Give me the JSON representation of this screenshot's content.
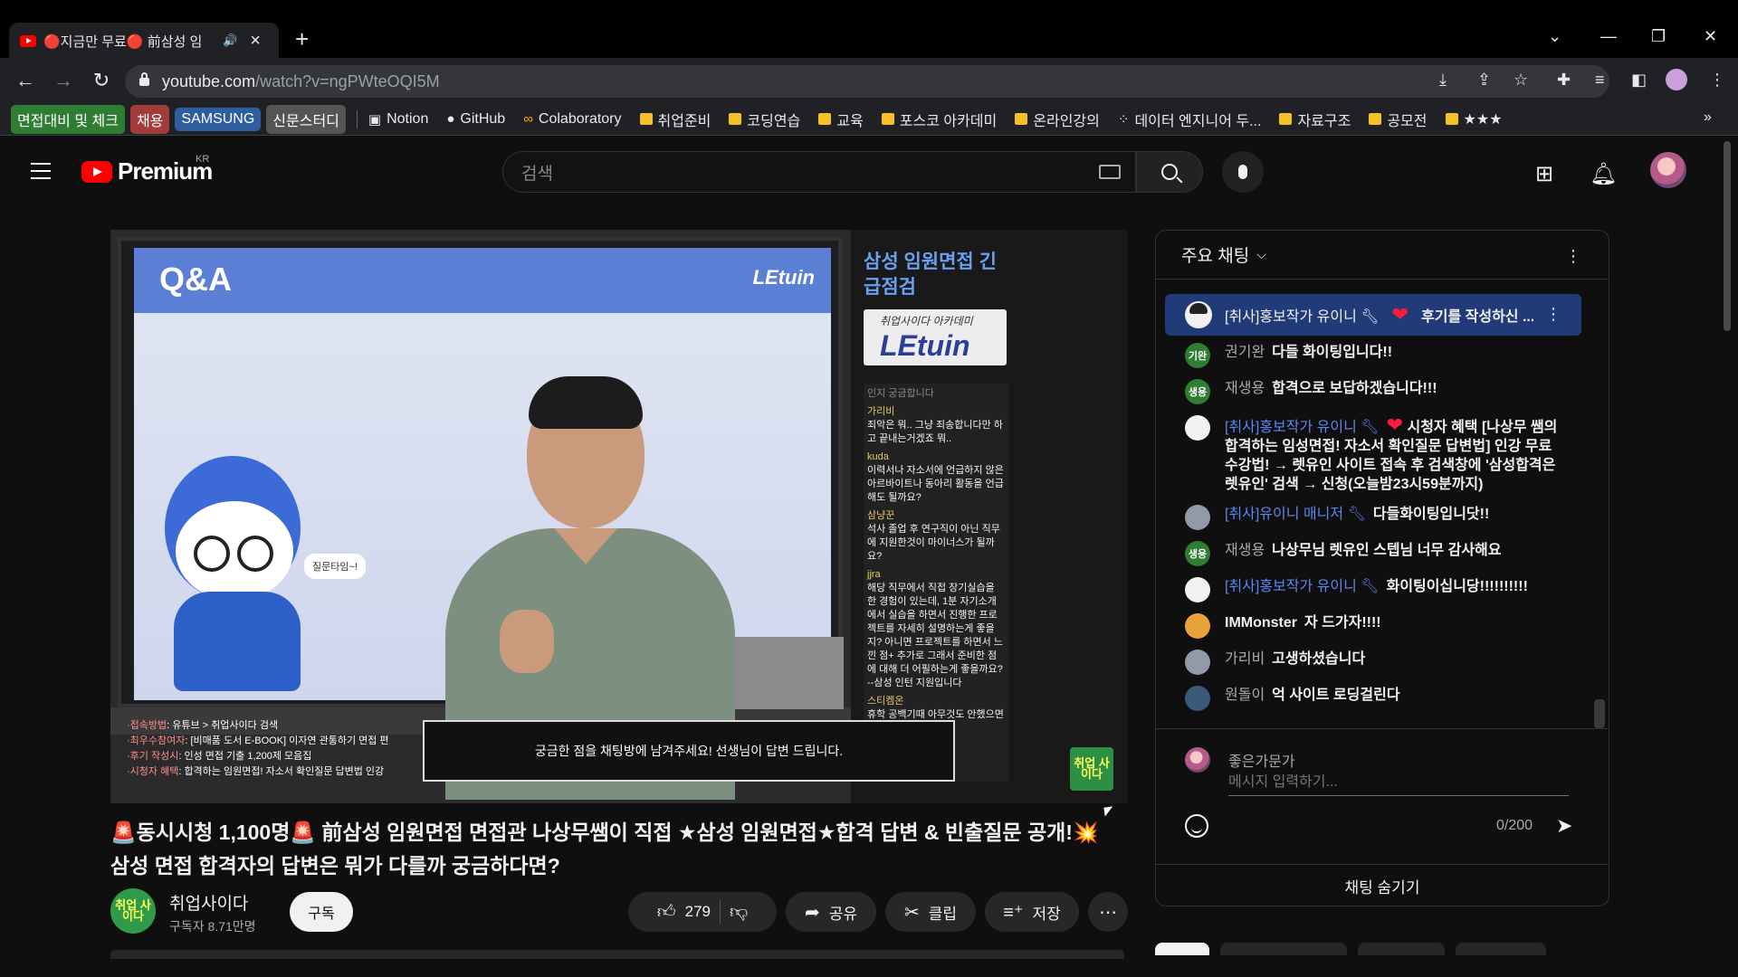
{
  "browser": {
    "tab_title": "🔴지금만 무료🔴 前삼성 임",
    "url_host": "youtube.com",
    "url_path": "/watch?v=ngPWteOQI5M",
    "bookmarks_chips": [
      {
        "label": "면접대비 및 체크",
        "color": "#2e7d32"
      },
      {
        "label": "채용",
        "color": "#a33b3b"
      },
      {
        "label": "SAMSUNG",
        "color": "#2f5e9e"
      },
      {
        "label": "신문스터디",
        "color": "#555555"
      }
    ],
    "bookmarks": [
      {
        "label": "Notion",
        "icon": "notion-icon"
      },
      {
        "label": "GitHub",
        "icon": "github-icon"
      },
      {
        "label": "Colaboratory",
        "icon": "colab-icon"
      },
      {
        "label": "취업준비",
        "icon": "folder-icon"
      },
      {
        "label": "코딩연습",
        "icon": "folder-icon"
      },
      {
        "label": "교육",
        "icon": "folder-icon"
      },
      {
        "label": "포스코 아카데미",
        "icon": "folder-icon"
      },
      {
        "label": "온라인강의",
        "icon": "folder-icon"
      },
      {
        "label": "데이터 엔지니어 두...",
        "icon": "dots-icon"
      },
      {
        "label": "자료구조",
        "icon": "folder-icon"
      },
      {
        "label": "공모전",
        "icon": "folder-icon"
      },
      {
        "label": "★★★",
        "icon": "folder-icon"
      }
    ]
  },
  "youtube": {
    "logo_text": "Premium",
    "region": "KR",
    "search_placeholder": "검색"
  },
  "video": {
    "screen_title": "Q&A",
    "screen_brand": "LEtuin",
    "bubble_text": "질문타임~!",
    "side_title": "삼성 임원면접 긴급점검",
    "side_logo_top": "취업사이다 아카데미",
    "side_logo_bottom": "LEtuin",
    "side_chat": [
      {
        "name": "",
        "text": "인지 궁금합니다"
      },
      {
        "name": "가리비",
        "text": "죄악은 뭐.. 그냥 죄송합니다만 하고 끝내는거겠죠 뭐.."
      },
      {
        "name": "kuda",
        "text": "이력서나 자소서에 언급하지 않은 아르바이트나 동아리 활동을 언급해도 될까요?"
      },
      {
        "name": "삼냥꾼",
        "text": "석사 졸업 후 연구직이 아닌 직무에 지원한것이 마이너스가 될까요?"
      },
      {
        "name": "jjra",
        "text": "해당 직무에서 직접 장기실습을 한 경험이 있는데, 1분 자기소개에서 실습을 하면서 진행한 프로젝트를 자세히 설명하는게 좋을지? 아니면 프로젝트를 하면서 느낀 점+ 추가로 그래서 준비한 점에 대해 더 어필하는게 좋을까요? --삼성 인턴 지원입니다"
      },
      {
        "name": "스티켐온",
        "text": "휴학 공백기때 아무것도 안했으면 지우내야 하나요??"
      }
    ],
    "side_badge": "취업 사이다",
    "lower_info": [
      {
        "key": "·접속방법",
        "value": ": 유튜브 > 취업사이다 검색"
      },
      {
        "key": "·최우수참여자",
        "value": ": [비매품 도서 E-BOOK] 이자연 관통하기 면접 편"
      },
      {
        "key": "·후기 작성시",
        "value": ": 인성 면접 기출 1,200제 모음집"
      },
      {
        "key": "·시청자 혜택",
        "value": ": 합격하는 임원면접! 자소서 확인질문 답변법 인강"
      }
    ],
    "question_bar": "궁금한 점을 채팅방에 남겨주세요! 선생님이 답변 드립니다.",
    "title": "🚨동시시청 1,100명🚨 前삼성 임원면접 면접관 나상무쌤이 직접 ★삼성 임원면접★합격 답변 & 빈출질문 공개!💥 삼성 면접 합격자의 답변은 뭐가 다를까 궁금하다면?",
    "channel_name": "취업사이다",
    "subscribers": "구독자 8.71만명",
    "subscribe_label": "구독",
    "likes": "279",
    "share_label": "공유",
    "clip_label": "클립",
    "save_label": "저장"
  },
  "chat": {
    "header": "주요 채팅",
    "pinned": {
      "author": "[취사]홍보작가 유이니",
      "text": "후기를 작성하신 ..."
    },
    "messages": [
      {
        "avatar_text": "기완",
        "avatar_color": "#2e7d32",
        "author": "권기완",
        "style": "normal",
        "text": "다들 화이팅입니다!!",
        "bold_text": true
      },
      {
        "avatar_text": "생용",
        "avatar_color": "#2e7d32",
        "author": "재생용",
        "style": "normal",
        "text": "합격으로 보답하겠습니다!!!",
        "bold_text": true
      },
      {
        "avatar_text": "",
        "avatar_color": "#f1f1f1",
        "author": "[취사]홍보작가 유이니",
        "style": "mod",
        "heart": true,
        "text": "시청자 혜택 [나상무 쌤의 합격하는 임성면접! 자소서 확인질문 답변법] 인강 무료 수강법! → 렛유인 사이트 접속 후 검색창에 '삼성합격은렛유인' 검색 → 신청(오늘밤23시59분까지)",
        "bold_text": false
      },
      {
        "avatar_text": "",
        "avatar_color": "#909aa8",
        "author": "[취사]유이니 매니저",
        "style": "mod",
        "text": "다들화이팅입니닷!!",
        "bold_text": true
      },
      {
        "avatar_text": "생용",
        "avatar_color": "#2e7d32",
        "author": "재생용",
        "style": "normal",
        "text": "나상무님 렛유인 스텝님 너무 감사해요",
        "bold_text": true
      },
      {
        "avatar_text": "",
        "avatar_color": "#f1f1f1",
        "author": "[취사]홍보작가 유이니",
        "style": "mod",
        "text": "화이팅이십니당!!!!!!!!!!",
        "bold_text": true
      },
      {
        "avatar_text": "",
        "avatar_color": "#e8a23a",
        "author": "IMMonster",
        "style": "boldauthor",
        "text": "자 드가자!!!!",
        "bold_text": true
      },
      {
        "avatar_text": "",
        "avatar_color": "#909aa8",
        "author": "가리비",
        "style": "normal",
        "text": "고생하셨습니다",
        "bold_text": true
      },
      {
        "avatar_text": "",
        "avatar_color": "#3a5a7a",
        "author": "원돌이",
        "style": "normal",
        "text": "억 사이트 로딩걸린다",
        "bold_text": true
      }
    ],
    "my_name": "좋은가문가",
    "input_placeholder": "메시지 입력하기...",
    "char_count": "0/200",
    "hide_label": "채팅 숨기기"
  }
}
